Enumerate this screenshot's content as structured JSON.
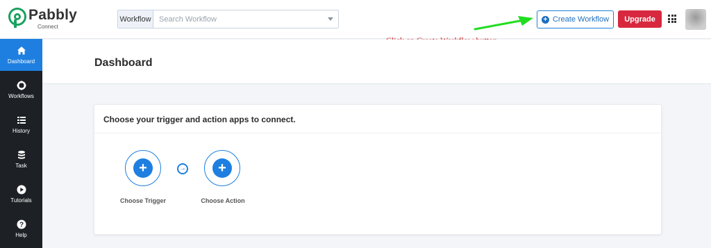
{
  "header": {
    "brand_name": "Pabbly",
    "brand_sub": "Connect",
    "search_prefix": "Workflow",
    "search_placeholder": "Search Workflow",
    "create_label": "Create Workflow",
    "upgrade_label": "Upgrade"
  },
  "annotation": {
    "text": "Click on Create Workflow button",
    "color": "#d21e1e",
    "arrow_color": "#22dd22"
  },
  "sidebar": {
    "items": [
      {
        "label": "Dashboard",
        "icon": "home-icon"
      },
      {
        "label": "Workflows",
        "icon": "workflows-icon"
      },
      {
        "label": "History",
        "icon": "history-icon"
      },
      {
        "label": "Task",
        "icon": "task-icon"
      },
      {
        "label": "Tutorials",
        "icon": "play-icon"
      },
      {
        "label": "Help",
        "icon": "help-icon"
      }
    ]
  },
  "main": {
    "title": "Dashboard",
    "card_title": "Choose your trigger and action apps to connect.",
    "trigger_label": "Choose Trigger",
    "action_label": "Choose Action"
  },
  "colors": {
    "accent": "#1e7fe0",
    "upgrade": "#d8283f",
    "sidebar": "#1d2025",
    "brand": "#19a15f"
  }
}
